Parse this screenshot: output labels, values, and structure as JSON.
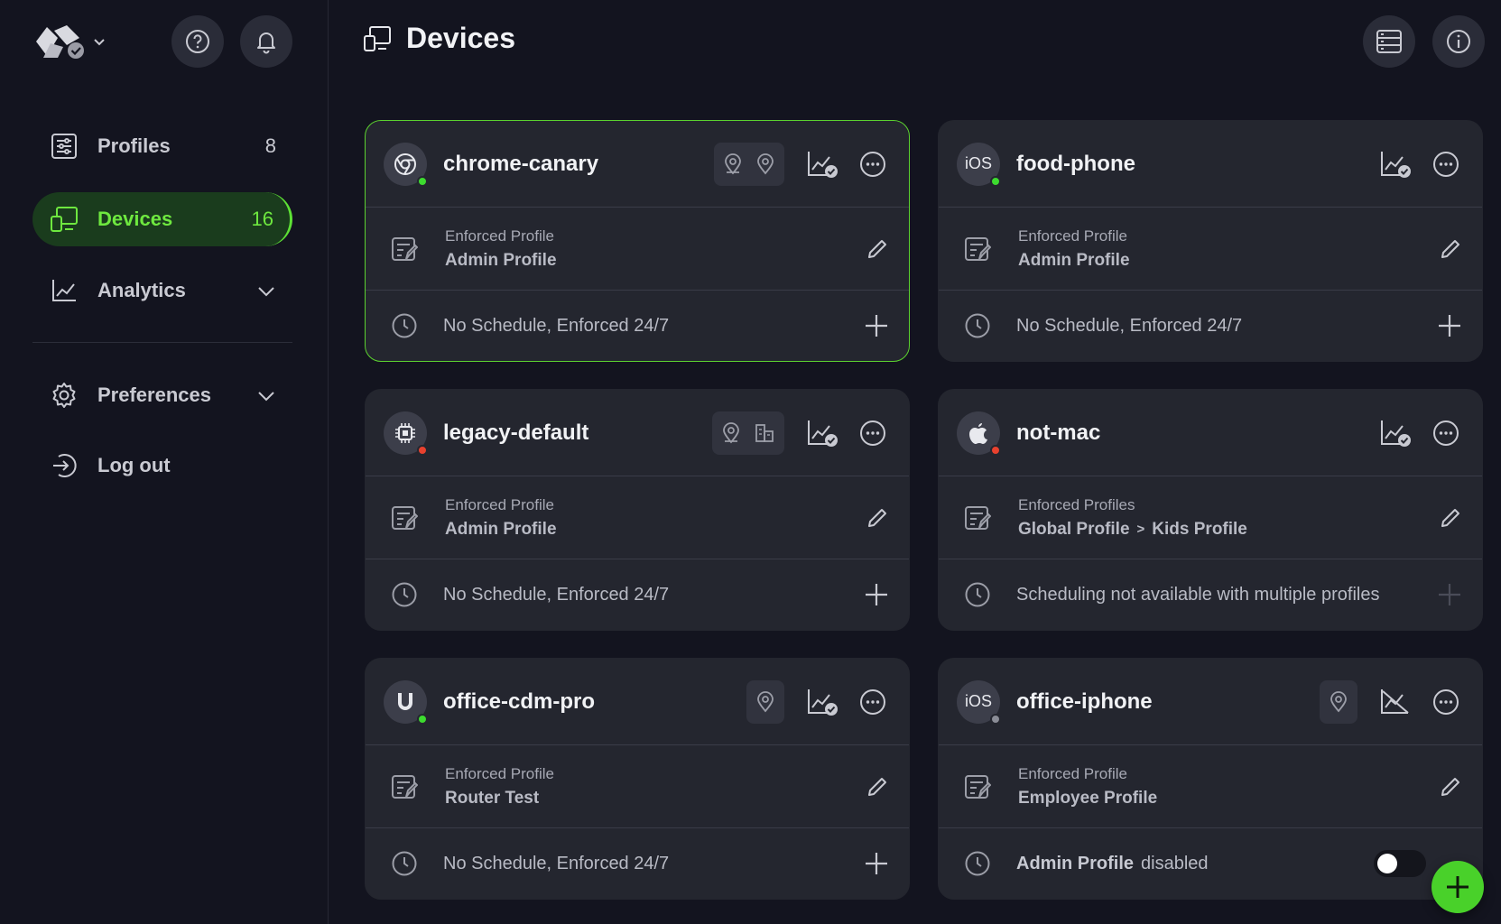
{
  "colors": {
    "accent": "#5de135",
    "online": "#3ddb2f",
    "offline": "#e8412e",
    "unknown": "#8a8c96"
  },
  "sidebar": {
    "items": [
      {
        "label": "Profiles",
        "count": "8"
      },
      {
        "label": "Devices",
        "count": "16"
      },
      {
        "label": "Analytics"
      },
      {
        "label": "Preferences"
      },
      {
        "label": "Log out"
      }
    ]
  },
  "header": {
    "title": "Devices"
  },
  "common": {
    "enforced_profile": "Enforced Profile",
    "enforced_profiles": "Enforced Profiles",
    "no_schedule": "No Schedule, Enforced 24/7"
  },
  "devices": [
    {
      "name": "chrome-canary",
      "icon": "chrome-icon",
      "status": "online",
      "profile": "Admin Profile"
    },
    {
      "name": "food-phone",
      "icon_text": "iOS",
      "status": "online",
      "profile": "Admin Profile"
    },
    {
      "name": "legacy-default",
      "icon": "chip-icon",
      "status": "offline",
      "profile": "Admin Profile"
    },
    {
      "name": "not-mac",
      "icon": "apple-icon",
      "status": "offline",
      "profiles": [
        "Global Profile",
        "Kids Profile"
      ],
      "separator": ">",
      "schedule_note": "Scheduling not available with multiple profiles"
    },
    {
      "name": "office-cdm-pro",
      "icon": "ubiquiti-icon",
      "status": "online",
      "profile": "Router Test"
    },
    {
      "name": "office-iphone",
      "icon_text": "iOS",
      "status": "unknown",
      "profile": "Employee Profile",
      "override_profile": "Admin Profile",
      "override_state": "disabled"
    }
  ]
}
